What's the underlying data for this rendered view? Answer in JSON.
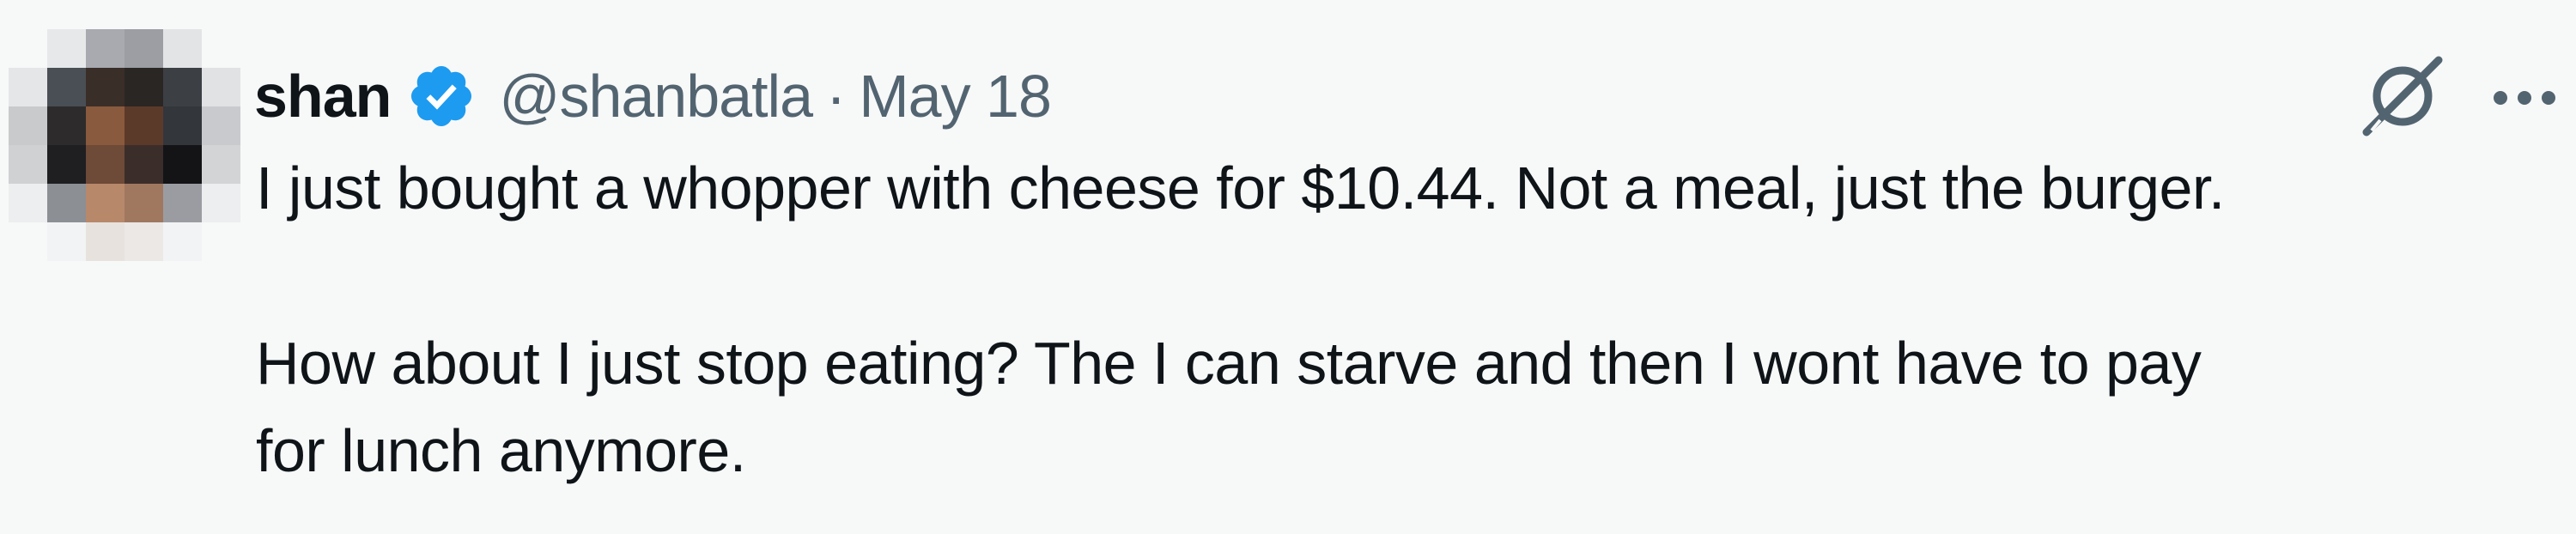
{
  "tweet": {
    "author": {
      "display_name": "shan",
      "handle": "@shanbatla",
      "verified": true,
      "avatar": "pixelated-avatar"
    },
    "separator": "·",
    "date": "May 18",
    "text": {
      "line1": "I just bought a whopper with cheese for $10.44. Not a meal, just the burger.",
      "line2": "How about I just stop eating? The I can starve and then I wont have to pay",
      "line3": "for lunch anymore."
    },
    "actions": {
      "grok_icon": "grok-icon",
      "more_icon": "more-icon"
    },
    "colors": {
      "verified_blue": "#1d9bf0",
      "secondary_text": "#536471",
      "primary_text": "#0f1419",
      "background": "#f7f8f8"
    }
  }
}
